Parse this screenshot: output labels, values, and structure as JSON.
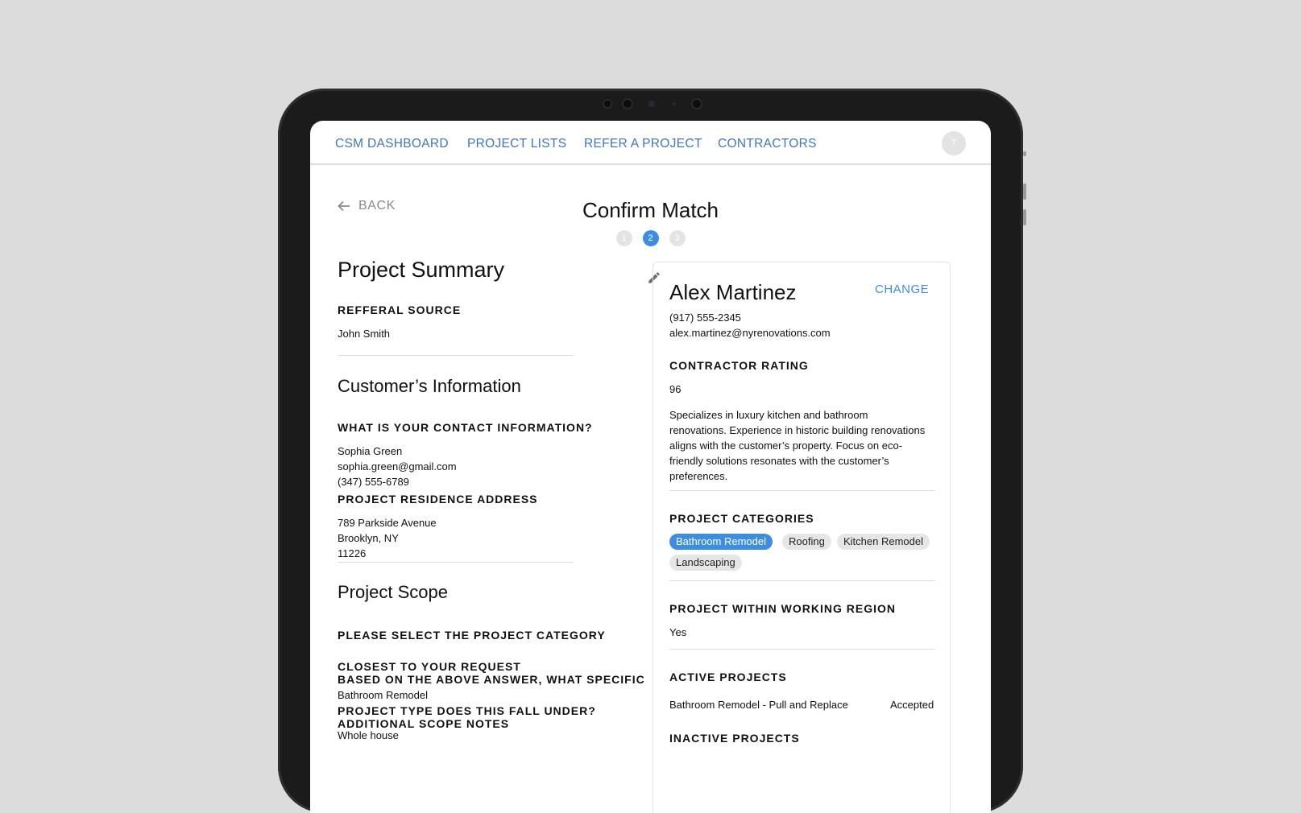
{
  "nav": {
    "items": [
      {
        "label": "CSM DASHBOARD"
      },
      {
        "label": "PROJECT LISTS"
      },
      {
        "label": "REFER A PROJECT"
      },
      {
        "label": "CONTRACTORS"
      }
    ],
    "avatar_initial": "T"
  },
  "header": {
    "back_label": "BACK",
    "title": "Confirm Match",
    "steps": [
      "1",
      "2",
      "3"
    ],
    "active_step": 2
  },
  "summary": {
    "title": "Project Summary",
    "referral_label": "REFFERAL SOURCE",
    "referral_value": "John Smith",
    "customer_title": "Customer’s Information",
    "contact_label": "WHAT IS YOUR CONTACT INFORMATION?",
    "contact_name": "Sophia Green",
    "contact_email": "sophia.green@gmail.com",
    "contact_phone": "(347) 555-6789",
    "address_label": "PROJECT RESIDENCE ADDRESS",
    "address_line1": "789 Parkside Avenue",
    "address_line2": "Brooklyn, NY",
    "address_zip": "11226",
    "scope_title": "Project Scope",
    "category_label_line1": "PLEASE SELECT THE PROJECT CATEGORY",
    "category_label_line2": "CLOSEST TO YOUR REQUEST",
    "type_label_line1": "BASED ON THE ABOVE ANSWER, WHAT SPECIFIC",
    "category_value": "Bathroom Remodel",
    "type_label_line2": "PROJECT TYPE DOES THIS FALL UNDER?",
    "notes_label": "ADDITIONAL SCOPE NOTES",
    "notes_value": "Whole house"
  },
  "contractor": {
    "name": "Alex Martinez",
    "change_label": "CHANGE",
    "phone": "(917) 555-2345",
    "email": "alex.martinez@nyrenovations.com",
    "rating_label": "CONTRACTOR RATING",
    "rating_value": "96",
    "description_lines": [
      "Specializes in luxury kitchen and bathroom",
      "renovations. Experience in historic building renovations",
      "aligns with the customer’s property. Focus on eco-",
      "friendly solutions resonates with the customer’s",
      "preferences."
    ],
    "categories_label": "PROJECT CATEGORIES",
    "categories": [
      {
        "label": "Bathroom Remodel",
        "selected": true
      },
      {
        "label": "Roofing",
        "selected": false
      },
      {
        "label": "Kitchen Remodel",
        "selected": false
      },
      {
        "label": "Landscaping",
        "selected": false
      }
    ],
    "region_label": "PROJECT WITHIN WORKING REGION",
    "region_value": "Yes",
    "active_label": "ACTIVE PROJECTS",
    "active_projects": [
      {
        "name": "Bathroom Remodel  - Pull and Replace",
        "status": "Accepted"
      }
    ],
    "inactive_label": "INACTIVE PROJECTS"
  },
  "colors": {
    "accent": "#3d8ee3",
    "nav_link": "#3d76c4",
    "background": "#dcdcdc"
  }
}
